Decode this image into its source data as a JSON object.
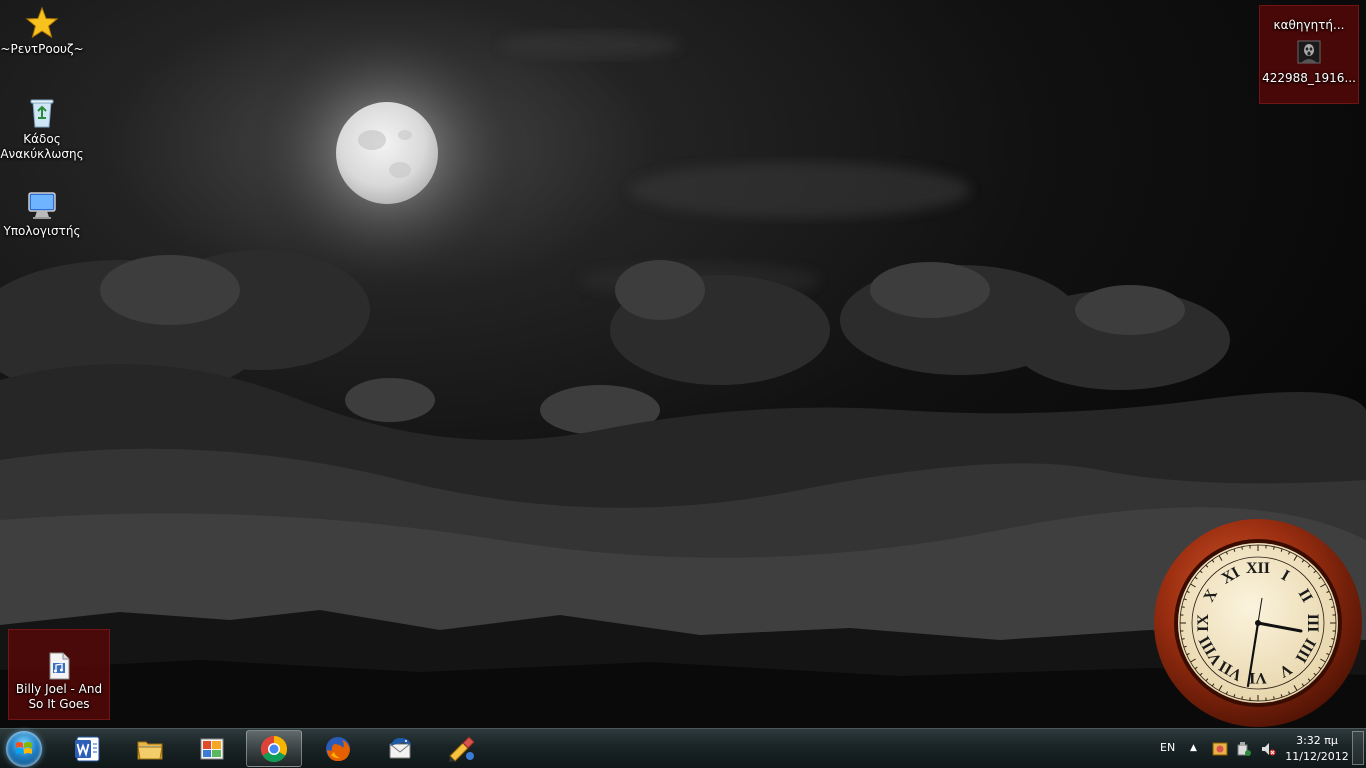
{
  "desktop": {
    "icons": [
      {
        "label": "~ΡεντΡοουζ~",
        "icon": "star-icon"
      },
      {
        "label": "Κάδος Ανακύκλωσης",
        "icon": "recycle-bin-icon"
      },
      {
        "label": "Υπολογιστής",
        "icon": "computer-icon"
      }
    ],
    "top_right_icon": {
      "label_top": "καθηγητή...",
      "label": "422988_1916...",
      "icon": "image-file-icon"
    },
    "selected_file": {
      "label": "Billy Joel - And So It Goes",
      "icon": "audio-file-icon"
    }
  },
  "taskbar": {
    "pinned": [
      {
        "name": "word",
        "icon": "word-icon"
      },
      {
        "name": "explorer",
        "icon": "folder-icon"
      },
      {
        "name": "paint",
        "icon": "paint-icon"
      },
      {
        "name": "chrome",
        "icon": "chrome-icon",
        "active": true
      },
      {
        "name": "firefox",
        "icon": "firefox-icon"
      },
      {
        "name": "thunderbird",
        "icon": "thunderbird-icon"
      },
      {
        "name": "tool",
        "icon": "brush-tool-icon"
      }
    ],
    "language": "EN",
    "time": "3:32 πμ",
    "date": "11/12/2012"
  },
  "colors": {
    "taskbar": "#1a2426",
    "selection": "#5a0808",
    "clock_wood": "#8a2a0e"
  }
}
